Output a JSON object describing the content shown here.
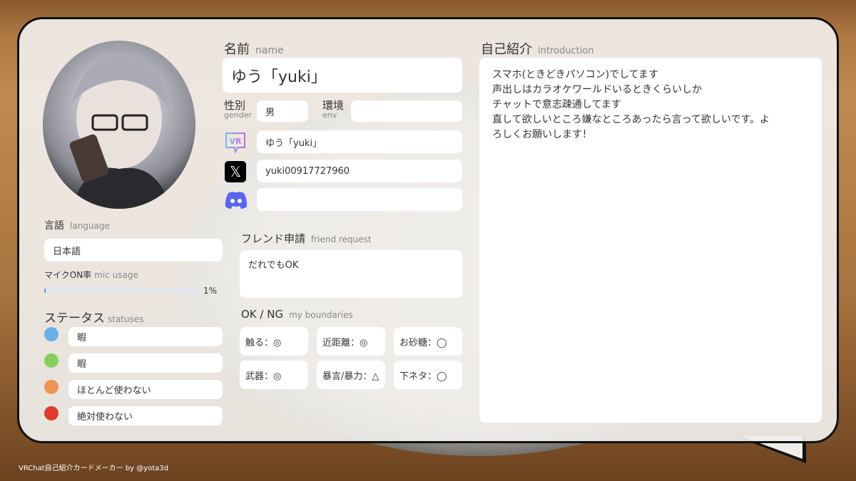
{
  "name": {
    "label": "名前",
    "sub": "name",
    "value": "ゆう「yuki」"
  },
  "gender": {
    "label": "性別",
    "sub": "gender",
    "value": "男"
  },
  "env": {
    "label": "環境",
    "sub": "env",
    "value": ""
  },
  "accounts": [
    {
      "icon": "vrchat-icon",
      "value": "ゆう「yuki」"
    },
    {
      "icon": "x-icon",
      "value": "yuki00917727960"
    },
    {
      "icon": "discord-icon",
      "value": ""
    }
  ],
  "language": {
    "label": "言語",
    "sub": "language",
    "value": "日本語"
  },
  "mic": {
    "label": "マイクON率",
    "sub": "mic usage",
    "percent": 1,
    "text": "1%"
  },
  "statuses": {
    "label": "ステータス",
    "sub": "statuses",
    "items": [
      {
        "color": "#6aaee8",
        "text": "暇"
      },
      {
        "color": "#86cf5a",
        "text": "暇"
      },
      {
        "color": "#ee9455",
        "text": "ほとんど使わない"
      },
      {
        "color": "#e03a2c",
        "text": "絶対使わない"
      }
    ]
  },
  "friend": {
    "label": "フレンド申請",
    "sub": "friend request",
    "value": "だれでもOK"
  },
  "boundaries": {
    "label": "OK / NG",
    "sub": "my boundaries",
    "items": [
      "触る：◎",
      "近距離：◎",
      "お砂糖：◯",
      "武器：◎",
      "暴言/暴力：△",
      "下ネタ：◯"
    ]
  },
  "intro": {
    "label": "自己紹介",
    "sub": "introduction",
    "lines": [
      "スマホ(ときどきパソコン)でしてます",
      "声出しはカラオケワールドいるときくらいしか",
      "チャットで意志疎通してます",
      "直して欲しいところ嫌なところあったら言って欲しいです。よ",
      "ろしくお願いします！"
    ]
  },
  "footer": "VRChat自己紹介カードメーカー by @yota3d"
}
